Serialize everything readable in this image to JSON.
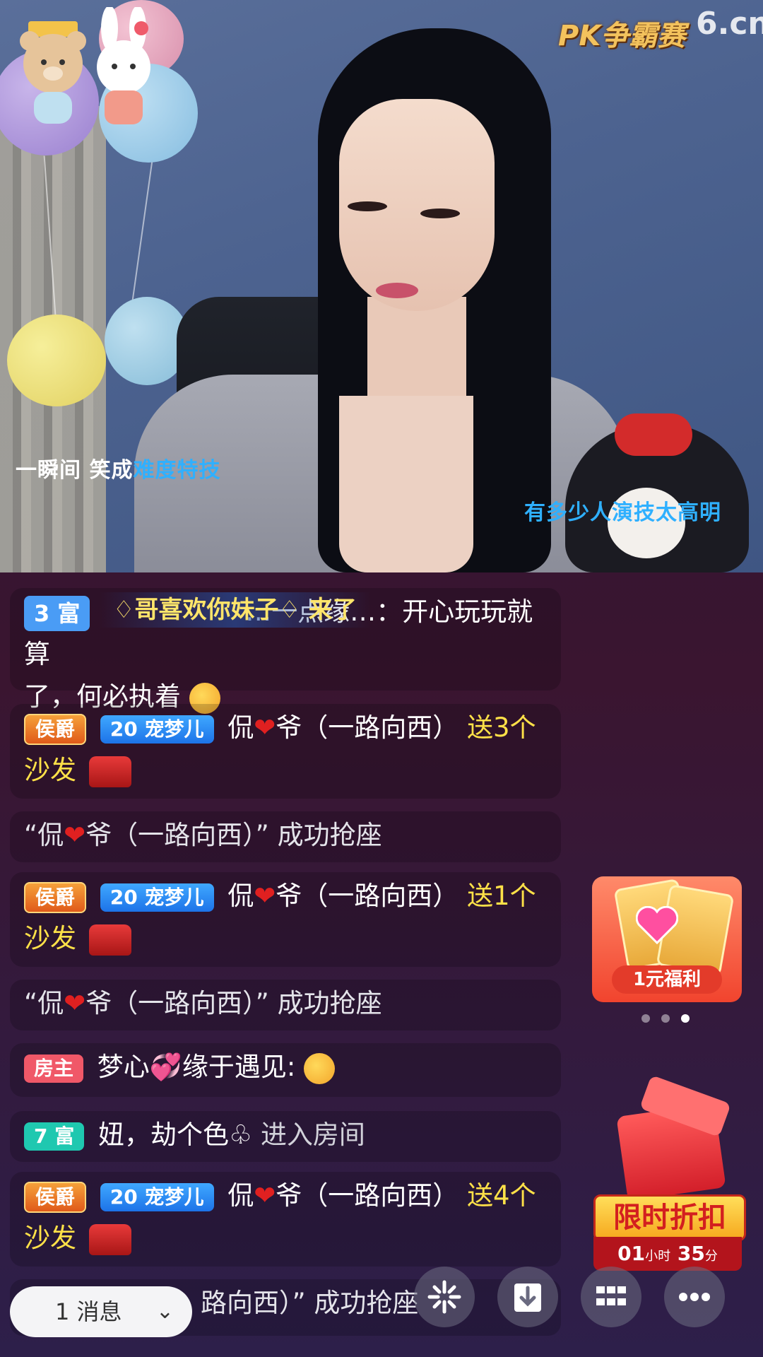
{
  "stream": {
    "watermark": "PK争霸赛",
    "site_logo": "6.cn",
    "lyric_line1_a": "一瞬间 笑成",
    "lyric_line1_b": "难度特技",
    "lyric_line2": "有多少人演技太高明"
  },
  "chat": {
    "floating_banner": "♢哥喜欢你妹子♢ 来了",
    "messages": [
      {
        "badge": "3 富",
        "text_a": "…一点缘…：开心玩玩就算",
        "text_b": "了，何必执着"
      },
      {
        "badge_noble": "侯爵",
        "badge_pet": "宠梦儿",
        "pet_level": "20",
        "name_a": "侃",
        "name_b": "爷（一路向西）",
        "gift": "送3个",
        "gift_item": "沙发"
      },
      {
        "sys_a": "“侃",
        "sys_b": "爷（一路向西）” 成功抢座"
      },
      {
        "badge_noble": "侯爵",
        "badge_pet": "宠梦儿",
        "pet_level": "20",
        "name_a": "侃",
        "name_b": "爷（一路向西）",
        "gift": "送1个",
        "gift_item": "沙发"
      },
      {
        "sys_a": "“侃",
        "sys_b": "爷（一路向西）” 成功抢座"
      },
      {
        "badge_host": "房主",
        "text": "梦心💞缘于遇见:"
      },
      {
        "badge_rich": "7 富",
        "name": "妞，劫个色♧",
        "action": "进入房间"
      },
      {
        "badge_noble": "侯爵",
        "badge_pet": "宠梦儿",
        "pet_level": "20",
        "name_a": "侃",
        "name_b": "爷（一路向西）",
        "gift": "送4个",
        "gift_item": "沙发"
      },
      {
        "sys_b": "路向西）” 成功抢座"
      }
    ]
  },
  "promos": {
    "welfare_label": "1元福利",
    "carousel_active": 2,
    "discount_title": "限时折扣",
    "timer_hours": "01",
    "timer_hours_unit": "小时",
    "timer_minutes": "35",
    "timer_minutes_unit": "分"
  },
  "bottom": {
    "message_count": "1",
    "message_label": "消息",
    "chevron": "⌄",
    "icons": [
      "sparkle-icon",
      "download-icon",
      "grid-icon",
      "more-icon"
    ]
  },
  "colors": {
    "gift_yellow": "#ffe148",
    "lyric_blue": "#2fb0ff",
    "background": "#2a1535"
  }
}
